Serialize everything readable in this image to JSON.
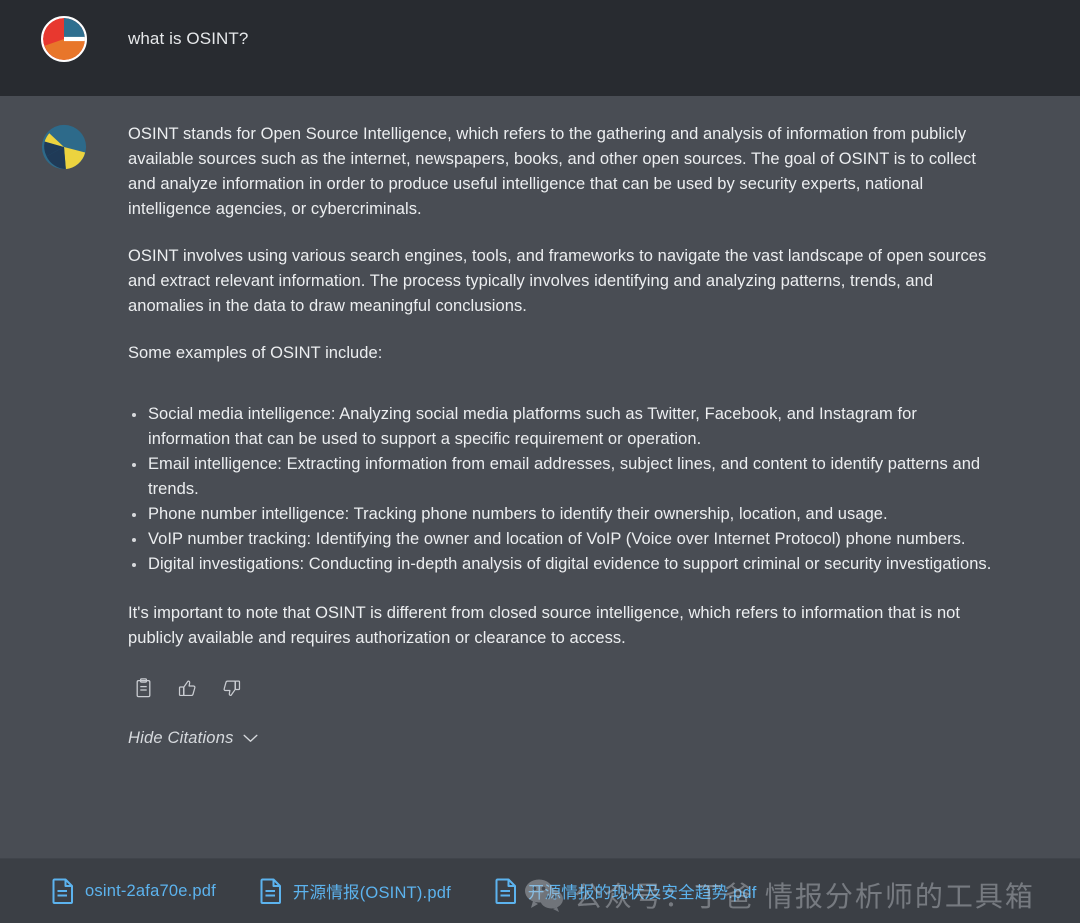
{
  "user_message": {
    "avatar_name": "user-pie-avatar",
    "text": "what is OSINT?",
    "avatar_colors": {
      "blue": "#2f6f8f",
      "red": "#e8382f",
      "orange": "#e8762a"
    }
  },
  "assistant_message": {
    "avatar_name": "assistant-pie-avatar",
    "avatar_colors": {
      "teal": "#2d6a8a",
      "dark_blue": "#1f3a57",
      "yellow": "#ecd33f"
    },
    "paragraphs": [
      "OSINT stands for Open Source Intelligence, which refers to the gathering and analysis of information from publicly available sources such as the internet, newspapers, books, and other open sources. The goal of OSINT is to collect and analyze information in order to produce useful intelligence that can be used by security experts, national intelligence agencies, or cybercriminals.",
      "OSINT involves using various search engines, tools, and frameworks to navigate the vast landscape of open sources and extract relevant information. The process typically involves identifying and analyzing patterns, trends, and anomalies in the data to draw meaningful conclusions.",
      "Some examples of OSINT include:"
    ],
    "examples": [
      "Social media intelligence: Analyzing social media platforms such as Twitter, Facebook, and Instagram for information that can be used to support a specific requirement or operation.",
      "Email intelligence: Extracting information from email addresses, subject lines, and content to identify patterns and trends.",
      "Phone number intelligence: Tracking phone numbers to identify their ownership, location, and usage.",
      "VoIP number tracking: Identifying the owner and location of VoIP (Voice over Internet Protocol) phone numbers.",
      "Digital investigations: Conducting in-depth analysis of digital evidence to support criminal or security investigations."
    ],
    "closing_paragraph": "It's important to note that OSINT is different from closed source intelligence, which refers to information that is not publicly available and requires authorization or clearance to access."
  },
  "actions": [
    {
      "name": "copy-button",
      "icon": "clipboard-icon"
    },
    {
      "name": "thumbs-up-button",
      "icon": "thumbs-up-icon"
    },
    {
      "name": "thumbs-down-button",
      "icon": "thumbs-down-icon"
    }
  ],
  "citations_toggle": {
    "label": "Hide Citations",
    "chevron": "chevron-down-icon"
  },
  "citations": [
    {
      "filename": "osint-2afa70e.pdf"
    },
    {
      "filename": "开源情报(OSINT).pdf"
    },
    {
      "filename": "开源情报的现状及安全趋势.pdf"
    }
  ],
  "watermark": {
    "text": "公众号：丁爸 情报分析师的工具箱",
    "icon": "wechat-icon"
  },
  "colors": {
    "user_row_bg": "#282b30",
    "assistant_row_bg": "#494d54",
    "citation_strip_bg": "#3b3f45",
    "link_blue": "#5cb3ee",
    "text": "#eceef0"
  }
}
